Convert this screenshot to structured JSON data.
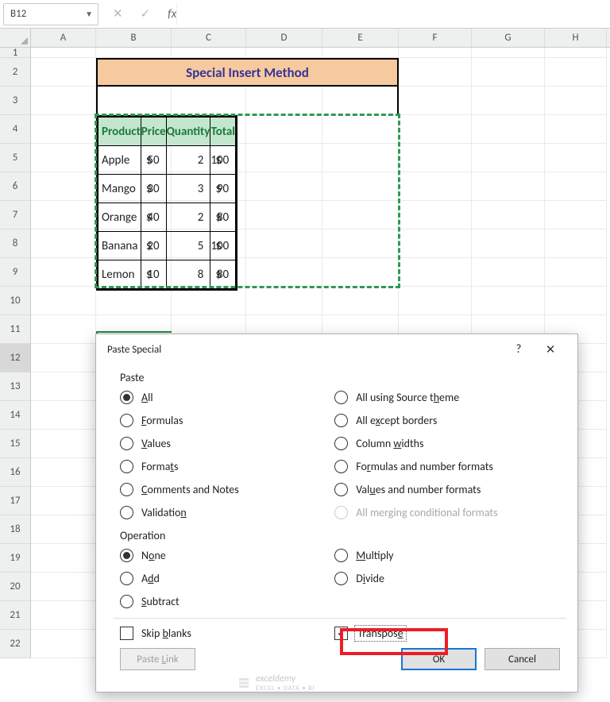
{
  "namebox": "B12",
  "columns": [
    "A",
    "B",
    "C",
    "D",
    "E",
    "F",
    "G",
    "H"
  ],
  "rows": [
    "1",
    "2",
    "3",
    "4",
    "5",
    "6",
    "7",
    "8",
    "9",
    "10",
    "11",
    "12",
    "13",
    "14",
    "15",
    "16",
    "17",
    "18",
    "19",
    "20",
    "21",
    "22"
  ],
  "table": {
    "title": "Special Insert Method",
    "headers": [
      "Product",
      "Price",
      "Quantity",
      "Total"
    ],
    "rows": [
      {
        "product": "Apple",
        "price": "50",
        "qty": "2",
        "total": "100"
      },
      {
        "product": "Mango",
        "price": "30",
        "qty": "3",
        "total": "90"
      },
      {
        "product": "Orange",
        "price": "40",
        "qty": "2",
        "total": "80"
      },
      {
        "product": "Banana",
        "price": "20",
        "qty": "5",
        "total": "100"
      },
      {
        "product": "Lemon",
        "price": "10",
        "qty": "8",
        "total": "80"
      }
    ],
    "currency": "$"
  },
  "dialog": {
    "title": "Paste Special",
    "help": "?",
    "close": "✕",
    "paste_label": "Paste",
    "operation_label": "Operation",
    "paste_left": [
      {
        "pre": "",
        "u": "A",
        "post": "ll",
        "sel": true
      },
      {
        "pre": "",
        "u": "F",
        "post": "ormulas",
        "sel": false
      },
      {
        "pre": "",
        "u": "V",
        "post": "alues",
        "sel": false
      },
      {
        "pre": "Forma",
        "u": "t",
        "post": "s",
        "sel": false
      },
      {
        "pre": "",
        "u": "C",
        "post": "omments and Notes",
        "sel": false
      },
      {
        "pre": "Validatio",
        "u": "n",
        "post": "",
        "sel": false
      }
    ],
    "paste_right": [
      {
        "pre": "All using Source t",
        "u": "h",
        "post": "eme",
        "sel": false
      },
      {
        "pre": "All e",
        "u": "x",
        "post": "cept borders",
        "sel": false
      },
      {
        "pre": "Column ",
        "u": "w",
        "post": "idths",
        "sel": false
      },
      {
        "pre": "Fo",
        "u": "r",
        "post": "mulas and number formats",
        "sel": false
      },
      {
        "pre": "Val",
        "u": "u",
        "post": "es and number formats",
        "sel": false
      },
      {
        "pre": "All mer",
        "u": "g",
        "post": "ing conditional formats",
        "sel": false,
        "dis": true
      }
    ],
    "op_left": [
      {
        "pre": "N",
        "u": "o",
        "post": "ne",
        "sel": true
      },
      {
        "pre": "A",
        "u": "d",
        "post": "d",
        "sel": false
      },
      {
        "pre": "",
        "u": "S",
        "post": "ubtract",
        "sel": false
      }
    ],
    "op_right": [
      {
        "pre": "",
        "u": "M",
        "post": "ultiply",
        "sel": false
      },
      {
        "pre": "D",
        "u": "i",
        "post": "vide",
        "sel": false
      }
    ],
    "skip": {
      "pre": "Skip ",
      "u": "b",
      "post": "lanks",
      "checked": false
    },
    "transpose": {
      "pre": "Transpos",
      "u": "e",
      "post": "",
      "checked": true
    },
    "paste_link": {
      "pre": "Paste ",
      "u": "L",
      "post": "ink"
    },
    "ok": "OK",
    "cancel": "Cancel"
  },
  "watermark": {
    "brand": "exceldemy",
    "tag": "EXCEL • DATA • BI"
  }
}
